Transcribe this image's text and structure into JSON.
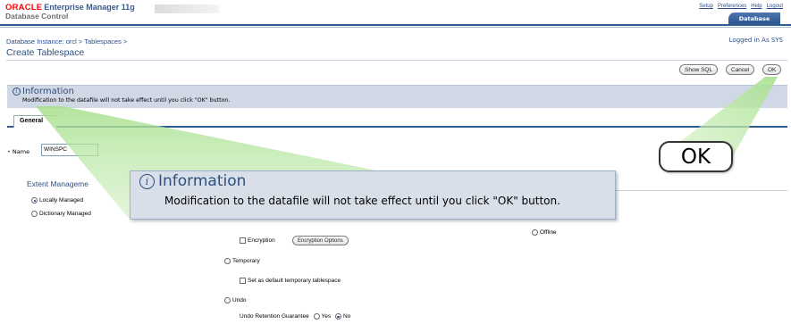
{
  "header": {
    "brand": "ORACLE",
    "product": "Enterprise Manager 11g",
    "subtitle": "Database Control",
    "links": [
      "Setup",
      "Preferences",
      "Help",
      "Logout"
    ],
    "tab": "Database"
  },
  "breadcrumb": {
    "item1": "Database Instance: orcl",
    "sep1": " > ",
    "item2": "Tablespaces",
    "sep2": " >"
  },
  "logged_in": "Logged in As SYS",
  "page_title": "Create Tablespace",
  "actions": {
    "show_sql": "Show SQL",
    "cancel": "Cancel",
    "ok": "OK"
  },
  "info": {
    "title": "Information",
    "message": "Modification to the datafile will not take effect until you click \"OK\" button."
  },
  "tabs": {
    "general": "General"
  },
  "form": {
    "name_label": "Name",
    "name_value": "WINSPC",
    "extent_heading": "Extent Manageme",
    "locally_managed": "Locally Managed",
    "dictionary_managed": "Dictionary Managed",
    "encryption": "Encryption",
    "encryption_options": "Encryption Options",
    "offline": "Offline",
    "temporary": "Temporary",
    "set_default_temp": "Set as default temporary tablespace",
    "undo": "Undo",
    "undo_retention": "Undo Retention Guarantee",
    "yes": "Yes",
    "no": "No"
  },
  "callout": {
    "title": "Information",
    "message": "Modification to the datafile will not take effect until you click \"OK\" button.",
    "ok": "OK"
  }
}
